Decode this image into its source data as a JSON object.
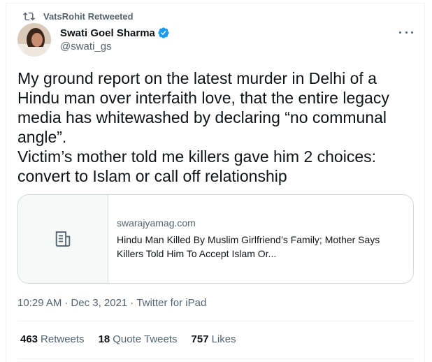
{
  "retweet_banner": {
    "label": "VatsRohit Retweeted"
  },
  "author": {
    "name": "Swati Goel Sharma",
    "handle": "@swati_gs"
  },
  "tweet": {
    "text": "My ground report on the latest murder in Delhi of a Hindu man over interfaith love, that the entire legacy media has whitewashed by declaring “no communal angle”.\nVictim’s mother told me killers gave him 2 choices: convert to Islam or call off relationship"
  },
  "link_card": {
    "domain": "swarajyamag.com",
    "title": "Hindu Man Killed By Muslim Girlfriend’s Family; Mother Says Killers Told Him To Accept Islam Or..."
  },
  "meta": {
    "time": "10:29 AM",
    "date": "Dec 3, 2021",
    "source": "Twitter for iPad",
    "separator": "·"
  },
  "stats": {
    "retweets_count": "463",
    "retweets_label": "Retweets",
    "quotes_count": "18",
    "quotes_label": "Quote Tweets",
    "likes_count": "757",
    "likes_label": "Likes"
  },
  "colors": {
    "verified": "#1d9bf0",
    "secondary_text": "#536471",
    "border": "#cfd9de"
  }
}
